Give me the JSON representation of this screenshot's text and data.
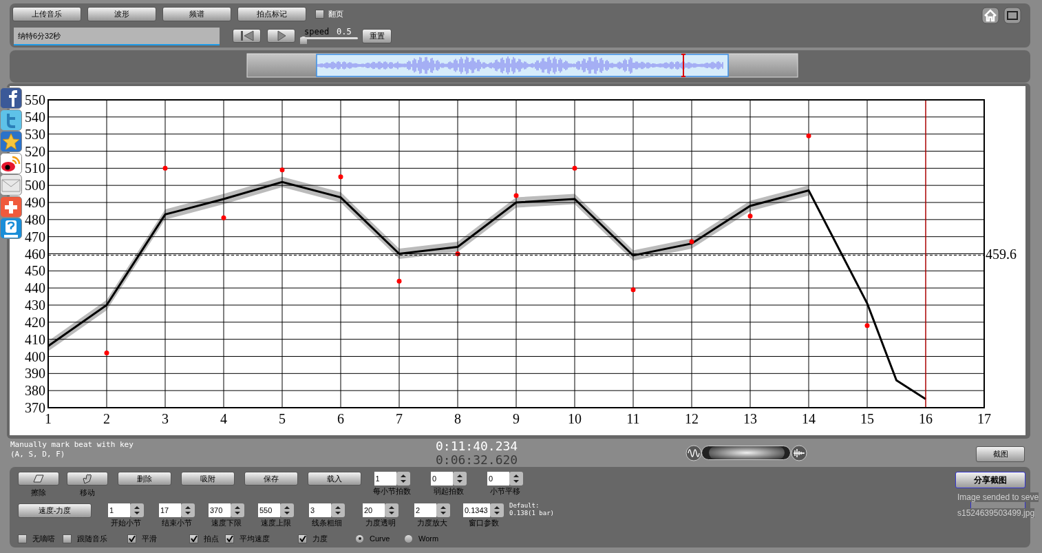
{
  "toolbar": {
    "buttons": [
      "上传音乐",
      "波形",
      "频谱",
      "拍点标记"
    ],
    "page_turn": {
      "label": "翻页",
      "checked": false
    },
    "title_field": {
      "value": "纳特6分32秒"
    },
    "speed": {
      "label": "speed",
      "reading": "0.5",
      "level": 0
    },
    "reset_button": "重置"
  },
  "chart": {
    "chart_data": {
      "type": "line",
      "x": [
        1,
        2,
        3,
        4,
        5,
        6,
        7,
        8,
        9,
        10,
        11,
        12,
        13,
        14,
        15,
        15.5,
        16
      ],
      "series": [
        {
          "color": "#000000",
          "values": [
            406,
            430,
            483,
            492,
            502,
            493,
            460,
            464,
            490,
            492,
            459,
            466,
            488,
            497,
            431,
            386,
            375
          ]
        },
        {
          "type": "scatter",
          "color": "#ff0000",
          "values": [
            null,
            402,
            510,
            481,
            509,
            505,
            444,
            460,
            494,
            510,
            439,
            467,
            482,
            529,
            418,
            null,
            null
          ]
        }
      ],
      "grid": true,
      "xlim": [
        1,
        17
      ],
      "ylim": [
        370,
        550
      ],
      "xticks": [
        1,
        2,
        3,
        4,
        5,
        6,
        7,
        8,
        9,
        10,
        11,
        12,
        13,
        14,
        15,
        16,
        17
      ],
      "yticks": [
        370,
        380,
        390,
        400,
        410,
        420,
        430,
        440,
        450,
        460,
        470,
        480,
        490,
        500,
        510,
        520,
        530,
        540,
        550
      ],
      "ref_lines": [
        {
          "axis": "y",
          "value": 459.6,
          "label": "459.6"
        },
        {
          "axis": "x",
          "value": 16,
          "color": "#ff0000"
        }
      ]
    }
  },
  "zoom_slider": {
    "level": 0.5
  },
  "hint_lines": [
    "Manually mark beat with key",
    "(A, S, D, F)"
  ],
  "times": [
    "0:11:40.234",
    "0:06:32.620"
  ],
  "screenshot_button": "截图",
  "tools": [
    {
      "label": "擦除",
      "kind": "eraser"
    },
    {
      "label": "移动",
      "kind": "hand"
    }
  ],
  "actions": [
    "删除",
    "吸附",
    "保存",
    "载入"
  ],
  "spinners_row1": [
    {
      "value": "1",
      "label": "每小节拍数"
    },
    {
      "value": "0",
      "label": "弱起拍数"
    },
    {
      "value": "0",
      "label": "小节平移"
    }
  ],
  "mode_button": "速度-力度",
  "spinners_row2": [
    {
      "value": "1",
      "label": "开始小节"
    },
    {
      "value": "17",
      "label": "结束小节"
    },
    {
      "value": "370",
      "label": "速度下限"
    },
    {
      "value": "550",
      "label": "速度上限"
    },
    {
      "value": "3",
      "label": "线条粗细"
    },
    {
      "value": "20",
      "label": "力度透明"
    },
    {
      "value": "2",
      "label": "力度放大"
    },
    {
      "value": "0.1343",
      "label": "窗口参数"
    }
  ],
  "default_note": [
    "Default:",
    "0.138(1 bar)"
  ],
  "options": [
    {
      "label": "无嘀嗒",
      "kind": "checkbox",
      "checked": false
    },
    {
      "label": "跟随音乐",
      "kind": "checkbox",
      "checked": false
    },
    {
      "label": "平滑",
      "kind": "checkbox",
      "checked": true
    },
    {
      "label": "拍点",
      "kind": "checkbox",
      "checked": true
    },
    {
      "label": "平均速度",
      "kind": "checkbox",
      "checked": true
    },
    {
      "label": "力度",
      "kind": "checkbox",
      "checked": true
    },
    {
      "label": "Curve",
      "kind": "radio",
      "selected": true
    },
    {
      "label": "Worm",
      "kind": "radio",
      "selected": false
    }
  ],
  "share_button": "分享截图",
  "status_lines": [
    "Image sended to seve",
    "s1524639503499.jpg"
  ]
}
